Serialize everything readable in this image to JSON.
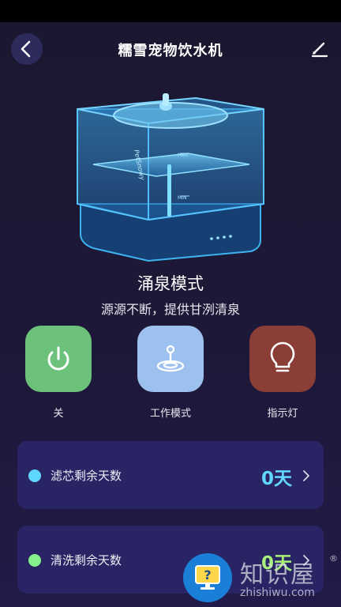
{
  "header": {
    "title": "糯雪宠物饮水机",
    "back_icon": "chevron-left-icon",
    "edit_icon": "pencil-icon"
  },
  "device": {
    "brand_label": "PetSnowy",
    "max_label": "MAX",
    "min_label": "MIN"
  },
  "mode": {
    "title": "涌泉模式",
    "description": "源源不断，提供甘洌清泉"
  },
  "controls": [
    {
      "label": "关",
      "icon": "power-icon",
      "color": "#6cc27b"
    },
    {
      "label": "工作模式",
      "icon": "fountain-icon",
      "color": "#9cc1ee"
    },
    {
      "label": "指示灯",
      "icon": "bulb-icon",
      "color": "#8b3e35"
    }
  ],
  "cards": [
    {
      "label": "滤芯剩余天数",
      "value": "0天",
      "dot_color": "#5fd7ff",
      "value_color": "#63d8ff"
    },
    {
      "label": "清洗剩余天数",
      "value": "0天",
      "dot_color": "#86f08d",
      "value_color": "#a7f07a"
    }
  ],
  "watermark": {
    "text_cn": "知识屋",
    "reg_mark": "®",
    "url": "zhishiwu.com",
    "help_icon": "help-monitor-icon"
  }
}
